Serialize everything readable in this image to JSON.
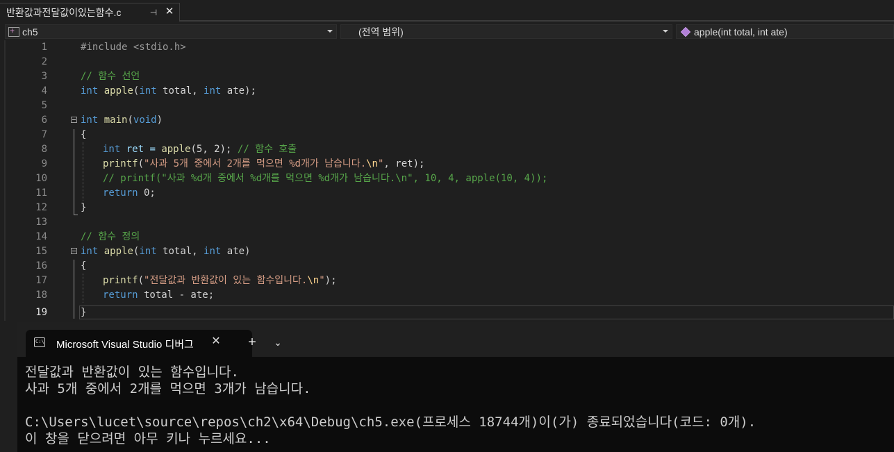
{
  "doc_tab": {
    "title": "반환값과전달값이있는함수.c",
    "pin": "⊣",
    "close": "✕"
  },
  "navbar": {
    "project": "ch5",
    "scope": "(전역 범위)",
    "function": "apple(int total, int ate)"
  },
  "editor": {
    "current_line": 19,
    "line_numbers": [
      "1",
      "2",
      "3",
      "4",
      "5",
      "6",
      "7",
      "8",
      "9",
      "10",
      "11",
      "12",
      "13",
      "14",
      "15",
      "16",
      "17",
      "18",
      "19"
    ],
    "lines": [
      [
        "#include <stdio.h>"
      ],
      [
        ""
      ],
      [
        "// 함수 선언"
      ],
      [
        "int",
        " apple",
        "(",
        "int",
        " total, ",
        "int",
        " ate);"
      ],
      [
        ""
      ],
      [
        "int",
        " main",
        "(",
        "void",
        ")"
      ],
      [
        "{"
      ],
      [
        "int",
        " ret = ",
        "apple",
        "(5, 2); ",
        "// 함수 호출"
      ],
      [
        "printf",
        "(",
        "\"사과 5개 중에서 2개를 먹으면 %d개가 남습니다.",
        "\\n",
        "\"",
        ", ret);"
      ],
      [
        "// printf(\"사과 %d개 중에서 %d개를 먹으면 %d개가 남습니다.\\n\", 10, 4, apple(10, 4));"
      ],
      [
        "return",
        " 0;"
      ],
      [
        "}"
      ],
      [
        ""
      ],
      [
        "// 함수 정의"
      ],
      [
        "int",
        " apple",
        "(",
        "int",
        " total, ",
        "int",
        " ate)"
      ],
      [
        "{"
      ],
      [
        "printf",
        "(",
        "\"전달값과 반환값이 있는 함수입니다.",
        "\\n",
        "\"",
        ");"
      ],
      [
        "return",
        " total - ate;"
      ],
      [
        "}"
      ]
    ]
  },
  "console": {
    "tab_title": "Microsoft Visual Studio 디버그",
    "tab_icon": "C:\\",
    "close": "✕",
    "new_tab": "+",
    "dropdown": "⌄",
    "output_lines": [
      "전달값과 반환값이 있는 함수입니다.",
      "사과 5개 중에서 2개를 먹으면 3개가 남습니다.",
      "",
      "C:\\Users\\lucet\\source\\repos\\ch2\\x64\\Debug\\ch5.exe(프로세스 18744개)이(가) 종료되었습니다(코드: 0개).",
      "이 창을 닫으려면 아무 키나 누르세요..."
    ]
  },
  "colors": {
    "keyword": "#569cd6",
    "function": "#dcdcaa",
    "comment": "#57a64a",
    "string": "#d69d85",
    "escape": "#ffd68f",
    "background": "#1f1f1f",
    "console_bg": "#0c0c0c"
  }
}
